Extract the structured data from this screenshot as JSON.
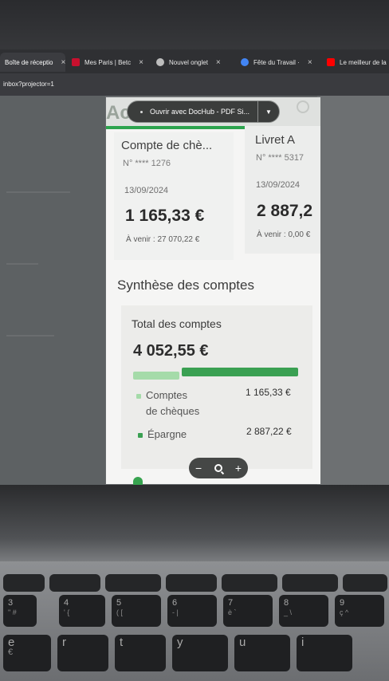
{
  "browser": {
    "tabs": [
      {
        "label": "Boîte de réceptio",
        "favicon_color": "#d93025",
        "active": true
      },
      {
        "label": "Mes Paris | Betc",
        "favicon_color": "#c8102e",
        "active": false
      },
      {
        "label": "Nouvel onglet",
        "favicon_color": "#bdbdbd",
        "active": false
      },
      {
        "label": "Fête du Travail ·",
        "favicon_color": "#4285f4",
        "active": false
      },
      {
        "label": "Le meilleur de la",
        "favicon_color": "#ff0000",
        "active": false
      }
    ],
    "url": "inbox?projector=1",
    "close_glyph": "×"
  },
  "viewer": {
    "logo_fragment": "Ac",
    "open_with_button": "Ouvrir avec DocHub - PDF Si...",
    "accent_color": "#2da44e"
  },
  "accounts": [
    {
      "title": "Compte de chè...",
      "number": "N° **** 1276",
      "date": "13/09/2024",
      "balance": "1 165,33 €",
      "upcoming": "À venir : 27 070,22 €"
    },
    {
      "title": "Livret A",
      "number": "N° **** 5317",
      "date": "13/09/2024",
      "balance": "2 887,2",
      "upcoming": "À venir : 0,00 €"
    }
  ],
  "synthesis": {
    "title": "Synthèse des comptes",
    "total_label": "Total des comptes",
    "total_amount": "4 052,55 €",
    "breakdown": [
      {
        "label_line1": "Comptes",
        "label_line2": "de chèques",
        "value": "1 165,33 €",
        "color": "#a5dba9",
        "share": 0.29
      },
      {
        "label_line1": "Épargne",
        "label_line2": "",
        "value": "2 887,22 €",
        "color": "#3aa052",
        "share": 0.71
      }
    ]
  },
  "zoom": {
    "minus": "−",
    "plus": "+"
  },
  "keyboard": {
    "row_numbers": [
      {
        "top": "3",
        "bottom": "\" #"
      },
      {
        "top": "4",
        "bottom": "' {"
      },
      {
        "top": "5",
        "bottom": "( ["
      },
      {
        "top": "6",
        "bottom": "- |"
      },
      {
        "top": "7",
        "bottom": "è `"
      },
      {
        "top": "8",
        "bottom": "_ \\"
      },
      {
        "top": "9",
        "bottom": "ç ^"
      }
    ],
    "row_letters": [
      "e",
      "r",
      "t",
      "y",
      "u",
      "i"
    ],
    "euro_glyph": "€"
  }
}
